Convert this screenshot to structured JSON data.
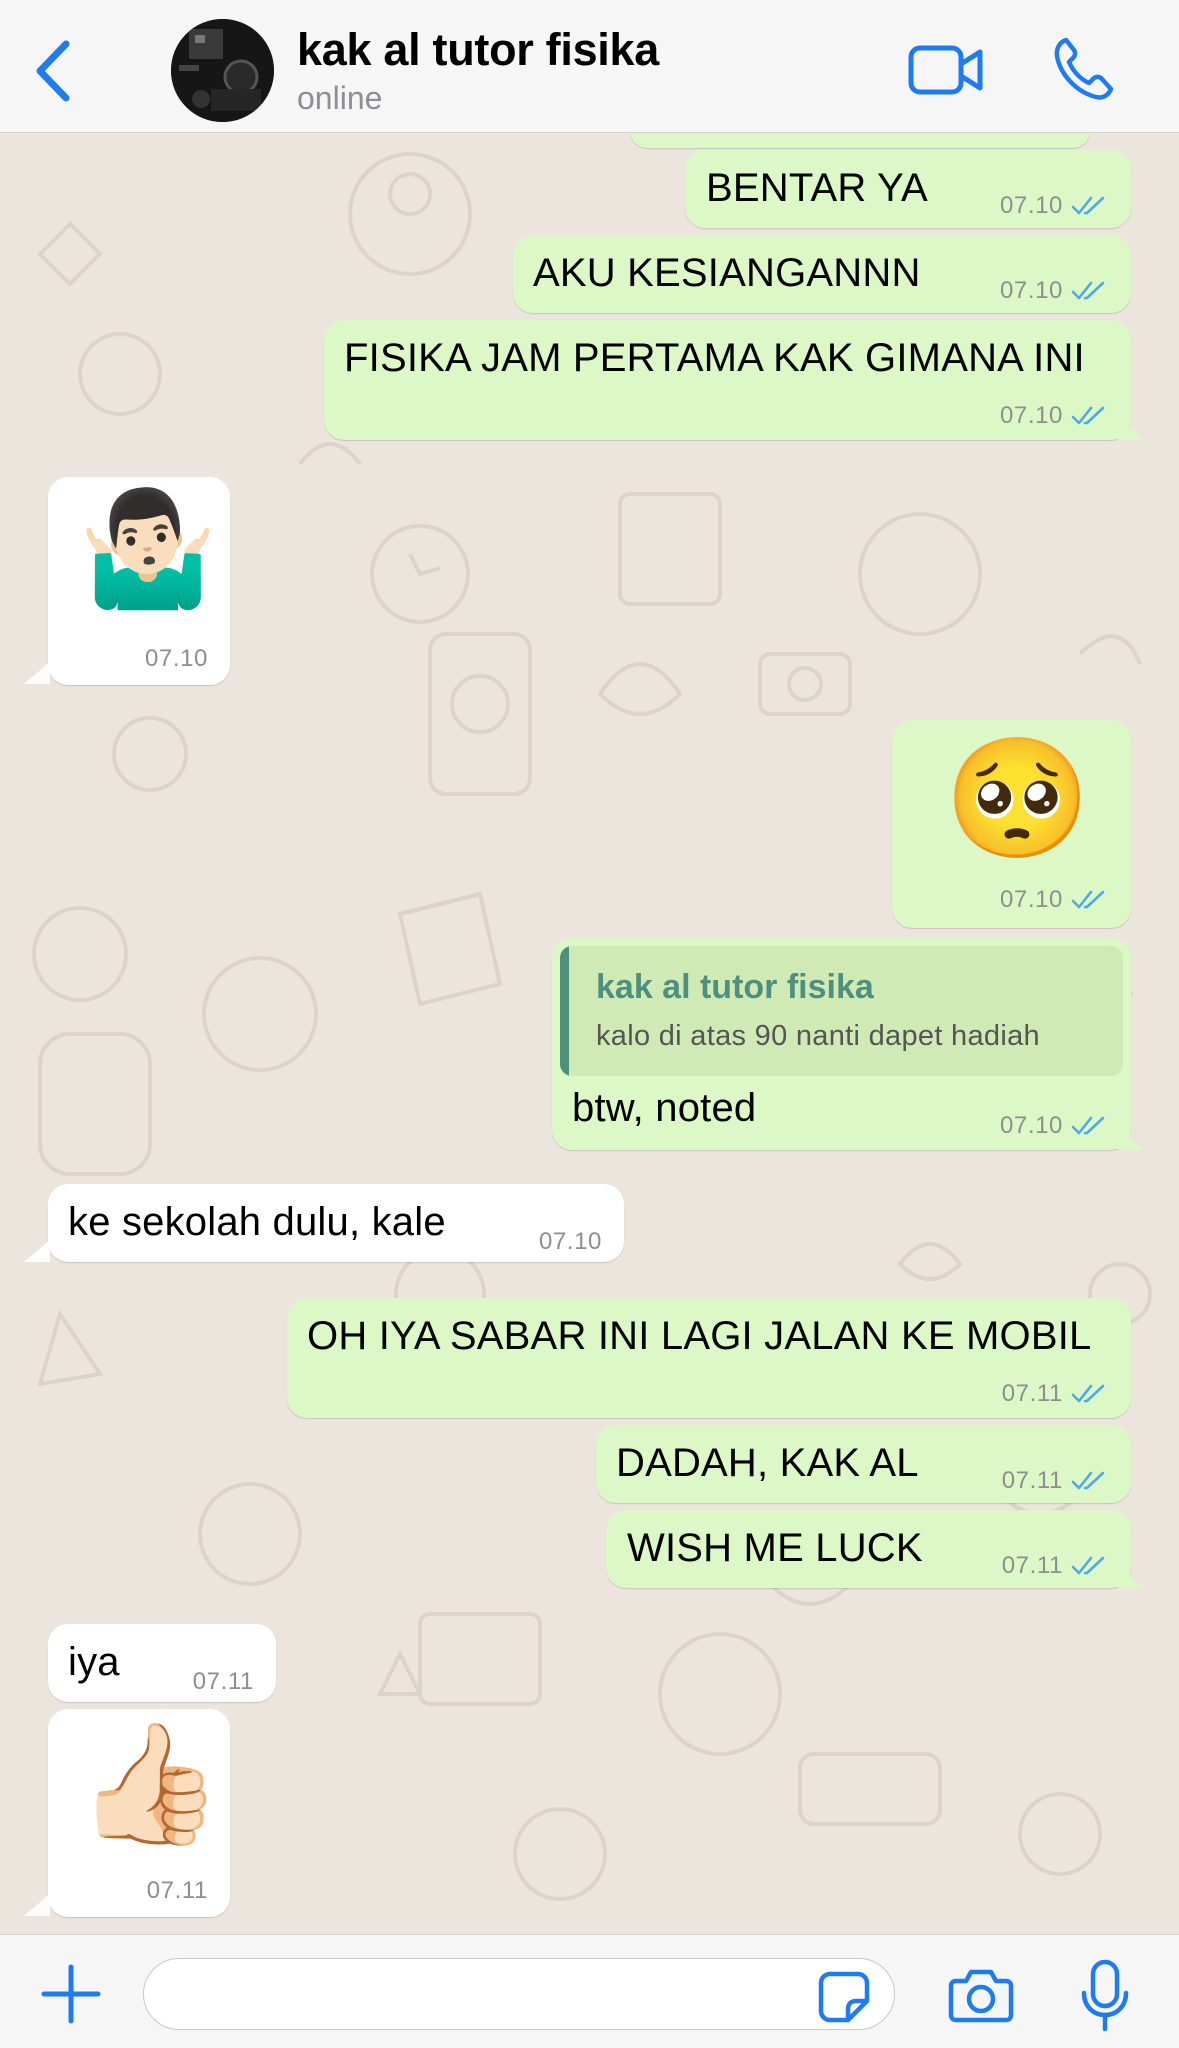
{
  "header": {
    "contact_name": "kak al tutor fisika",
    "status": "online",
    "back_icon": "chevron-left-icon",
    "video_icon": "video-camera-icon",
    "call_icon": "phone-icon"
  },
  "colors": {
    "accent": "#1f7bf2",
    "outgoing_bubble": "#dcf8c6",
    "incoming_bubble": "#ffffff",
    "wallpaper": "#ece5dd",
    "read_ticks": "#4fa8e8",
    "reply_name": "#4f8f7d"
  },
  "messages": [
    {
      "direction": "out",
      "text": "BENTAR YA",
      "time": "07.10",
      "status": "read"
    },
    {
      "direction": "out",
      "text": "AKU KESIANGANNN",
      "time": "07.10",
      "status": "read"
    },
    {
      "direction": "out",
      "text": "FISIKA JAM PERTAMA KAK GIMANA INI",
      "time": "07.10",
      "status": "read"
    },
    {
      "direction": "in",
      "emoji": "🤷🏻‍♂️",
      "time": "07.10"
    },
    {
      "direction": "out",
      "emoji": "🥺",
      "time": "07.10",
      "status": "read"
    },
    {
      "direction": "out",
      "reply_to": {
        "name": "kak al tutor fisika",
        "text": "kalo di atas 90 nanti dapet hadiah"
      },
      "text": "btw, noted",
      "time": "07.10",
      "status": "read"
    },
    {
      "direction": "in",
      "text": "ke sekolah dulu, kale",
      "time": "07.10"
    },
    {
      "direction": "out",
      "text": "OH IYA SABAR INI LAGI JALAN KE MOBIL",
      "time": "07.11",
      "status": "read"
    },
    {
      "direction": "out",
      "text": "DADAH, KAK AL",
      "time": "07.11",
      "status": "read"
    },
    {
      "direction": "out",
      "text": "WISH ME LUCK",
      "time": "07.11",
      "status": "read"
    },
    {
      "direction": "in",
      "text": "iya",
      "time": "07.11"
    },
    {
      "direction": "in",
      "emoji": "👍🏻",
      "time": "07.11"
    }
  ],
  "composer": {
    "placeholder": "",
    "plus_icon": "plus-icon",
    "sticker_icon": "sticker-icon",
    "camera_icon": "camera-icon",
    "mic_icon": "microphone-icon"
  }
}
